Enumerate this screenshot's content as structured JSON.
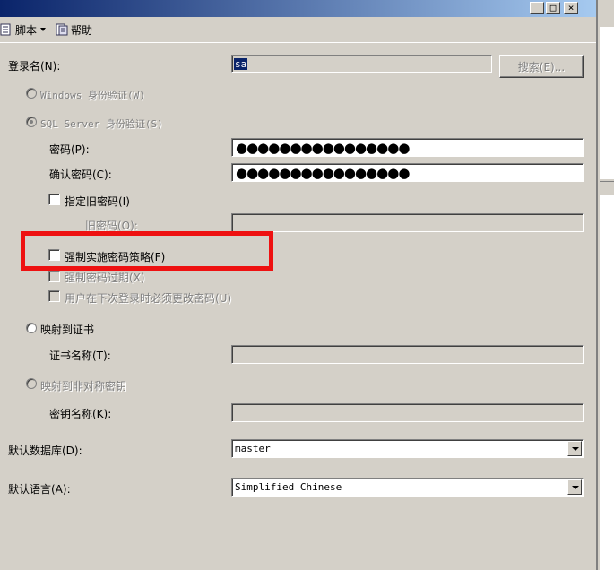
{
  "window": {
    "min": "_",
    "max": "□",
    "close": "×"
  },
  "toolbar": {
    "script_label": "脚本",
    "help_label": "帮助"
  },
  "form": {
    "login_name_label": "登录名(N):",
    "login_name_value": "sa",
    "search_button": "搜索(E)...",
    "windows_auth_label": "Windows 身份验证(W)",
    "sql_auth_label": "SQL Server 身份验证(S)",
    "password_label": "密码(P):",
    "password_mask": "●●●●●●●●●●●●●●●●",
    "confirm_password_label": "确认密码(C):",
    "confirm_password_mask": "●●●●●●●●●●●●●●●●",
    "specify_old_password_label": "指定旧密码(I)",
    "old_password_label": "旧密码(O):",
    "enforce_policy_label": "强制实施密码策略(F)",
    "enforce_expiration_label": "强制密码过期(X)",
    "must_change_label": "用户在下次登录时必须更改密码(U)",
    "map_certificate_label": "映射到证书",
    "certificate_name_label": "证书名称(T):",
    "map_asymmetric_label": "映射到非对称密钥",
    "key_name_label": "密钥名称(K):",
    "default_db_label": "默认数据库(D):",
    "default_db_value": "master",
    "default_lang_label": "默认语言(A):",
    "default_lang_value": "Simplified Chinese"
  },
  "colors": {
    "highlight": "#ee1111",
    "titlebar": "#0a246a",
    "background": "#d4d0c8"
  }
}
